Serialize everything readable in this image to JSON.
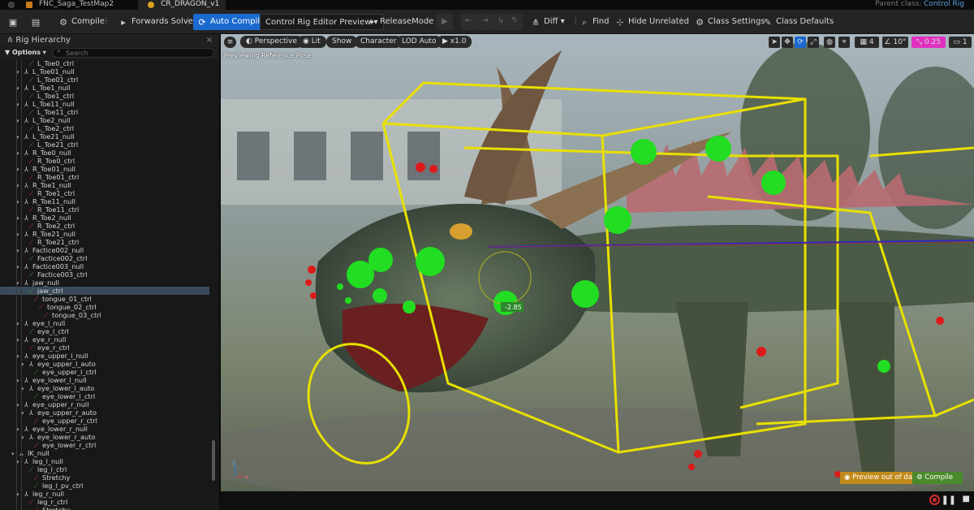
{
  "tabs": [
    {
      "label": "FNC_Saga_TestMap2"
    },
    {
      "label": "CR_DRAGON_v1"
    }
  ],
  "parent_class": {
    "prefix": "Parent class:",
    "value": "Control Rig"
  },
  "toolbar": {
    "compile": "Compile",
    "forwards_solve": "Forwards Solve",
    "auto_compile": "Auto Compile",
    "preview_mode": "Control Rig Editor Preview",
    "release_mode": "ReleaseMode",
    "diff": "Diff",
    "find": "Find",
    "hide_unrelated": "Hide Unrelated",
    "class_settings": "Class Settings",
    "class_defaults": "Class Defaults"
  },
  "panel": {
    "title": "Rig Hierarchy",
    "options": "Options",
    "search_placeholder": "Search"
  },
  "tree": [
    {
      "label": "L_Toe0_ctrl",
      "type": "ctrl",
      "depth": 4
    },
    {
      "label": "L_Toe01_null",
      "type": "null",
      "depth": 3
    },
    {
      "label": "L_Toe01_ctrl",
      "type": "ctrl",
      "depth": 4
    },
    {
      "label": "L_Toe1_null",
      "type": "null",
      "depth": 3
    },
    {
      "label": "L_Toe1_ctrl",
      "type": "ctrl",
      "depth": 4
    },
    {
      "label": "L_Toe11_null",
      "type": "null",
      "depth": 3
    },
    {
      "label": "L_Toe11_ctrl",
      "type": "ctrl",
      "depth": 4
    },
    {
      "label": "L_Toe2_null",
      "type": "null",
      "depth": 3
    },
    {
      "label": "L_Toe2_ctrl",
      "type": "ctrl",
      "depth": 4
    },
    {
      "label": "L_Toe21_null",
      "type": "null",
      "depth": 3
    },
    {
      "label": "L_Toe21_ctrl",
      "type": "ctrl",
      "depth": 4
    },
    {
      "label": "R_Toe0_null",
      "type": "null",
      "depth": 3
    },
    {
      "label": "R_Toe0_ctrl",
      "type": "red",
      "depth": 4
    },
    {
      "label": "R_Toe01_null",
      "type": "null",
      "depth": 3
    },
    {
      "label": "R_Toe01_ctrl",
      "type": "red",
      "depth": 4
    },
    {
      "label": "R_Toe1_null",
      "type": "null",
      "depth": 3
    },
    {
      "label": "R_Toe1_ctrl",
      "type": "red",
      "depth": 4
    },
    {
      "label": "R_Toe11_null",
      "type": "null",
      "depth": 3
    },
    {
      "label": "R_Toe11_ctrl",
      "type": "red",
      "depth": 4
    },
    {
      "label": "R_Toe2_null",
      "type": "null",
      "depth": 3
    },
    {
      "label": "R_Toe2_ctrl",
      "type": "red",
      "depth": 4
    },
    {
      "label": "R_Toe21_null",
      "type": "null",
      "depth": 3
    },
    {
      "label": "R_Toe21_ctrl",
      "type": "red",
      "depth": 4
    },
    {
      "label": "Factice002_null",
      "type": "null",
      "depth": 3
    },
    {
      "label": "Factice002_ctrl",
      "type": "ctrl",
      "depth": 4
    },
    {
      "label": "Factice003_null",
      "type": "null",
      "depth": 3
    },
    {
      "label": "Factice003_ctrl",
      "type": "ctrl",
      "depth": 4
    },
    {
      "label": "jaw_null",
      "type": "null",
      "depth": 3
    },
    {
      "label": "jaw_ctrl",
      "type": "ctrl",
      "depth": 4,
      "selected": true
    },
    {
      "label": "tongue_01_ctrl",
      "type": "red",
      "depth": 5
    },
    {
      "label": "tongue_02_ctrl",
      "type": "red",
      "depth": 6
    },
    {
      "label": "tongue_03_ctrl",
      "type": "red",
      "depth": 7
    },
    {
      "label": "eye_l_null",
      "type": "null",
      "depth": 3
    },
    {
      "label": "eye_l_ctrl",
      "type": "ctrl",
      "depth": 4
    },
    {
      "label": "eye_r_null",
      "type": "null",
      "depth": 3
    },
    {
      "label": "eye_r_ctrl",
      "type": "red",
      "depth": 4
    },
    {
      "label": "eye_upper_l_null",
      "type": "null",
      "depth": 3
    },
    {
      "label": "eye_upper_l_auto",
      "type": "null",
      "depth": 4
    },
    {
      "label": "eye_upper_l_ctrl",
      "type": "ctrl",
      "depth": 5
    },
    {
      "label": "eye_lower_l_null",
      "type": "null",
      "depth": 3
    },
    {
      "label": "eye_lower_l_auto",
      "type": "null",
      "depth": 4
    },
    {
      "label": "eye_lower_l_ctrl",
      "type": "ctrl",
      "depth": 5
    },
    {
      "label": "eye_upper_r_null",
      "type": "null",
      "depth": 3
    },
    {
      "label": "eye_upper_r_auto",
      "type": "null",
      "depth": 4
    },
    {
      "label": "eye_upper_r_ctrl",
      "type": "red",
      "depth": 5
    },
    {
      "label": "eye_lower_r_null",
      "type": "null",
      "depth": 3
    },
    {
      "label": "eye_lower_r_auto",
      "type": "null",
      "depth": 4
    },
    {
      "label": "eye_lower_r_ctrl",
      "type": "red",
      "depth": 5
    },
    {
      "label": "IK_null",
      "type": "null",
      "depth": 2
    },
    {
      "label": "leg_l_null",
      "type": "null",
      "depth": 3
    },
    {
      "label": "leg_l_ctrl",
      "type": "ctrl",
      "depth": 4
    },
    {
      "label": "Stretchy",
      "type": "red",
      "depth": 5
    },
    {
      "label": "leg_l_pv_ctrl",
      "type": "ctrl",
      "depth": 5
    },
    {
      "label": "leg_r_null",
      "type": "null",
      "depth": 3
    },
    {
      "label": "leg_r_ctrl",
      "type": "red",
      "depth": 4
    },
    {
      "label": "Stretchy",
      "type": "red",
      "depth": 5
    }
  ],
  "viewport": {
    "perspective": "Perspective",
    "lit": "Lit",
    "show": "Show",
    "character": "Character",
    "lod": "LOD Auto",
    "speed": "x1.0",
    "previewing": "Previewing Reference Pose",
    "grid": "4",
    "angle": "10°",
    "scale": "0.25",
    "camera": "1",
    "gizmo_value": "-2.85",
    "preview_out_of_date": "Preview out of date",
    "compile": "Compile"
  },
  "colors": {
    "accent": "#1b6ad0",
    "ctrl_green": "#3aa83a",
    "ctrl_red": "#d03a3a",
    "gizmo_yellow": "#e8e000",
    "control_green": "#22dd22"
  }
}
